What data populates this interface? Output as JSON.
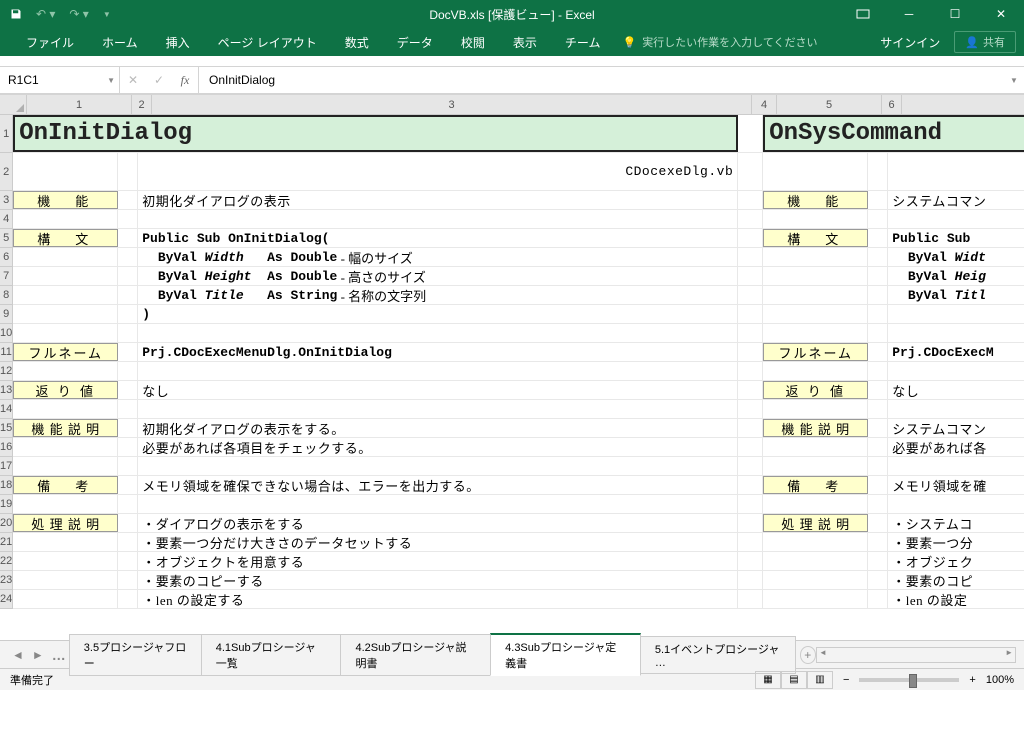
{
  "app": {
    "title": "DocVB.xls  [保護ビュー] - Excel"
  },
  "window": {
    "signin": "サインイン",
    "share": "共有"
  },
  "ribbon": {
    "tabs": [
      "ファイル",
      "ホーム",
      "挿入",
      "ページ レイアウト",
      "数式",
      "データ",
      "校閲",
      "表示",
      "チーム"
    ],
    "tellme": "実行したい作業を入力してください"
  },
  "formula": {
    "namebox": "R1C1",
    "value": "OnInitDialog"
  },
  "columns": [
    "1",
    "2",
    "3",
    "4",
    "5",
    "6"
  ],
  "rows": [
    "1",
    "2",
    "3",
    "4",
    "5",
    "6",
    "7",
    "8",
    "9",
    "10",
    "11",
    "12",
    "13",
    "14",
    "15",
    "16",
    "17",
    "18",
    "19",
    "20",
    "21",
    "22",
    "23",
    "24"
  ],
  "left": {
    "title": "OnInitDialog",
    "filename": "CDocexeDlg.vb",
    "labels": {
      "func": "機　能",
      "syntax": "構　文",
      "fullname": "フルネーム",
      "ret": "返 り 値",
      "funcdesc": "機 能 説 明",
      "note": "備　考",
      "procdesc": "処 理 説 明"
    },
    "content": {
      "func": "初期化ダイアログの表示",
      "syntax1": "Public Sub OnInitDialog(",
      "syntax2": "  ByVal Width   As Double - 幅のサイズ",
      "syntax3": "  ByVal Height  As Double - 高さのサイズ",
      "syntax4": "  ByVal Title   As String - 名称の文字列",
      "syntax5": ")",
      "fullname": "Prj.CDocExecMenuDlg.OnInitDialog",
      "ret": "なし",
      "funcdesc1": "初期化ダイアログの表示をする。",
      "funcdesc2": "必要があれば各項目をチェックする。",
      "note": "メモリ領域を確保できない場合は、エラーを出力する。",
      "proc1": "・ダイアログの表示をする",
      "proc2": "・要素一つ分だけ大きさのデータセットする",
      "proc3": "・オブジェクトを用意する",
      "proc4": "・要素のコピーする",
      "proc5": "・len の設定する"
    }
  },
  "right": {
    "title": "OnSysCommand",
    "labels": {
      "func": "機　能",
      "syntax": "構　文",
      "fullname": "フルネーム",
      "ret": "返 り 値",
      "funcdesc": "機 能 説 明",
      "note": "備　考",
      "procdesc": "処 理 説 明"
    },
    "content": {
      "func": "システムコマン",
      "syntax1": "Public Sub ",
      "syntax2": "  ByVal Widt",
      "syntax3": "  ByVal Heig",
      "syntax4": "  ByVal Titl",
      "fullname": "Prj.CDocExecM",
      "ret": "なし",
      "funcdesc1": "システムコマン",
      "funcdesc2": "必要があれば各",
      "note": "メモリ領域を確",
      "proc1": "・システムコ",
      "proc2": "・要素一つ分",
      "proc3": "・オブジェク",
      "proc4": "・要素のコピ",
      "proc5": "・len の設定"
    }
  },
  "sheets": {
    "tabs": [
      "3.5プロシージャフロー",
      "4.1Subプロシージャ一覧",
      "4.2Subプロシージャ説明書",
      "4.3Subプロシージャ定義書",
      "5.1イベントプロシージャ"
    ],
    "active": 3
  },
  "status": {
    "ready": "準備完了",
    "zoom": "100%"
  }
}
